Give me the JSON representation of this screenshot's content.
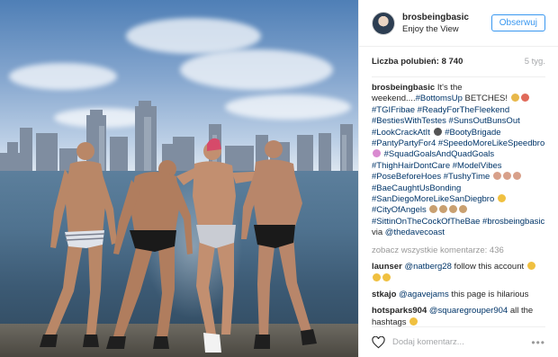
{
  "post": {
    "username": "brosbeingbasic",
    "location": "Enjoy the View",
    "follow_label": "Obserwuj",
    "likes_label": "Liczba polubień: 8 740",
    "time_ago": "5 tyg.",
    "caption_text_1": "It's the weekend....",
    "caption_tags_1": "#BottomsUp",
    "caption_text_2": " BETCHES! ",
    "caption_tags_block": "#TGIFribae #ReadyForTheFleekend #BestiesWithTestes #SunsOutBunsOut #LookCrackAtIt",
    "caption_tags_block_2": "#BootyBrigade #PantyPartyFor4 #SpeedoMoreLikeSpeedbro",
    "caption_tags_block_3": "#SquadGoalsAndQuadGoals #ThighHairDontCare #ModelVibes #PoseBeforeHoes #TushyTime",
    "caption_tags_block_4": "#BaeCaughtUsBonding #SanDiegoMoreLikeSanDiegbro",
    "caption_tags_block_5": "#CityOfAngels",
    "caption_tags_block_6": "#SittinOnTheCockOfTheBae #brosbeingbasic",
    "caption_via": " via ",
    "caption_via_user": "@thedavecoast",
    "view_all": "zobacz wszystkie komentarze: 436",
    "comments": [
      {
        "user": "launser",
        "mention": "@natberg28",
        "text": " follow this account"
      },
      {
        "user": "stkajo",
        "mention": "@agavejams",
        "text": " this page is hilarious"
      },
      {
        "user": "hotsparks904",
        "mention": "@squaregrouper904",
        "text": " all the hashtags "
      }
    ],
    "add_comment_placeholder": "Dodaj komentarz...",
    "more_label": "•••"
  },
  "icons": {
    "heart": "heart-outline-icon",
    "avatar": "avatar",
    "options": "more-options-icon"
  },
  "colors": {
    "accent": "#3897f0",
    "link": "#003569",
    "muted": "#a5a7aa"
  }
}
